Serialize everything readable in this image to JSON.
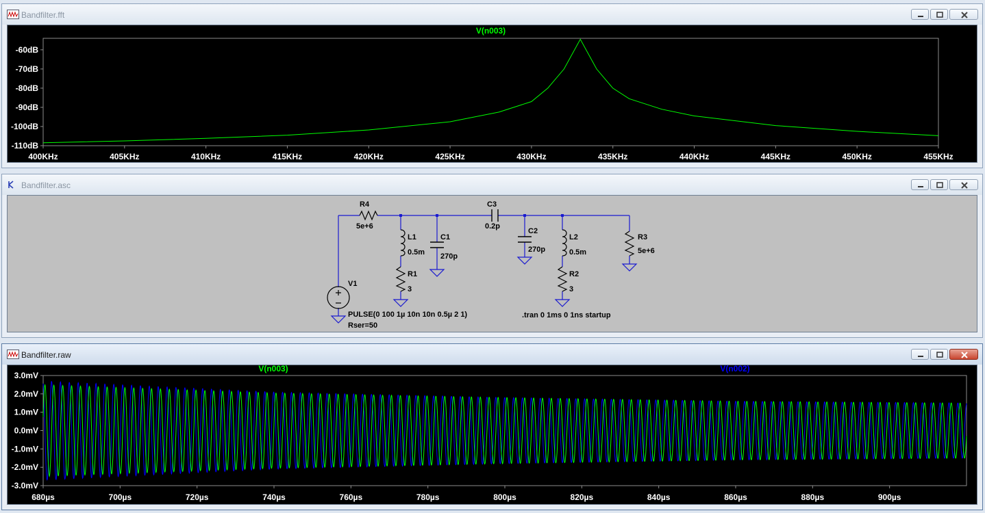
{
  "windows": {
    "fft": {
      "title": "Bandfilter.fft",
      "trace_label": "V(n003)",
      "trace_color": "#00ff00",
      "y_ticks": [
        "-60dB",
        "-70dB",
        "-80dB",
        "-90dB",
        "-100dB",
        "-110dB"
      ],
      "x_ticks": [
        "400KHz",
        "405KHz",
        "410KHz",
        "415KHz",
        "420KHz",
        "425KHz",
        "430KHz",
        "435KHz",
        "440KHz",
        "445KHz",
        "450KHz",
        "455KHz"
      ]
    },
    "schematic": {
      "title": "Bandfilter.asc",
      "components": {
        "r4": {
          "name": "R4",
          "value": "5e+6"
        },
        "c3": {
          "name": "C3",
          "value": "0.2p"
        },
        "l1": {
          "name": "L1",
          "value": "0.5m"
        },
        "c1": {
          "name": "C1",
          "value": "270p"
        },
        "r1": {
          "name": "R1",
          "value": "3"
        },
        "c2": {
          "name": "C2",
          "value": "270p"
        },
        "l2": {
          "name": "L2",
          "value": "0.5m"
        },
        "r2": {
          "name": "R2",
          "value": "3"
        },
        "r3": {
          "name": "R3",
          "value": "5e+6"
        },
        "v1": {
          "name": "V1",
          "value": "PULSE(0 100 1µ 10n 10n 0.5µ 2 1)",
          "rser": "Rser=50"
        }
      },
      "directive": ".tran 0 1ms 0 1ns startup",
      "wire_color": "#0000cc"
    },
    "raw": {
      "title": "Bandfilter.raw",
      "trace1_label": "V(n003)",
      "trace1_color": "#00ff00",
      "trace2_label": "V(n002)",
      "trace2_color": "#0000ff",
      "y_ticks": [
        "3.0mV",
        "2.0mV",
        "1.0mV",
        "0.0mV",
        "-1.0mV",
        "-2.0mV",
        "-3.0mV"
      ],
      "x_ticks": [
        "680µs",
        "700µs",
        "720µs",
        "740µs",
        "760µs",
        "780µs",
        "800µs",
        "820µs",
        "840µs",
        "860µs",
        "880µs",
        "900µs"
      ]
    }
  },
  "chart_data": [
    {
      "type": "line",
      "title": "V(n003)",
      "xlabel": "",
      "ylabel": "",
      "xlim": [
        400,
        455
      ],
      "x_unit": "KHz",
      "ylim": [
        -110,
        -54
      ],
      "y_unit": "dB",
      "grid": false,
      "series": [
        {
          "name": "V(n003)",
          "x": [
            400,
            405,
            410,
            415,
            420,
            425,
            428,
            430,
            431,
            432,
            433,
            434,
            435,
            436,
            438,
            440,
            445,
            450,
            455
          ],
          "y": [
            -108.5,
            -107.5,
            -106.2,
            -104.5,
            -101.8,
            -97.5,
            -92.5,
            -87,
            -80,
            -70,
            -54.5,
            -70,
            -80,
            -85.5,
            -91,
            -94.5,
            -99.5,
            -102.5,
            -104.8
          ]
        }
      ]
    },
    {
      "type": "line",
      "title": "",
      "xlabel": "",
      "ylabel": "",
      "xlim": [
        680,
        920
      ],
      "x_unit": "µs",
      "ylim": [
        -3,
        3
      ],
      "y_unit": "mV",
      "grid": false,
      "series": [
        {
          "name": "V(n003)",
          "envelope_t": [
            680,
            740,
            800,
            860,
            920
          ],
          "envelope_mV": [
            2.5,
            2.05,
            1.8,
            1.6,
            1.5
          ],
          "frequency_kHz": 433
        },
        {
          "name": "V(n002)",
          "envelope_t": [
            680,
            740,
            800,
            860,
            920
          ],
          "envelope_mV": [
            2.7,
            2.1,
            1.8,
            1.6,
            1.5
          ],
          "frequency_kHz": 433
        }
      ]
    }
  ]
}
